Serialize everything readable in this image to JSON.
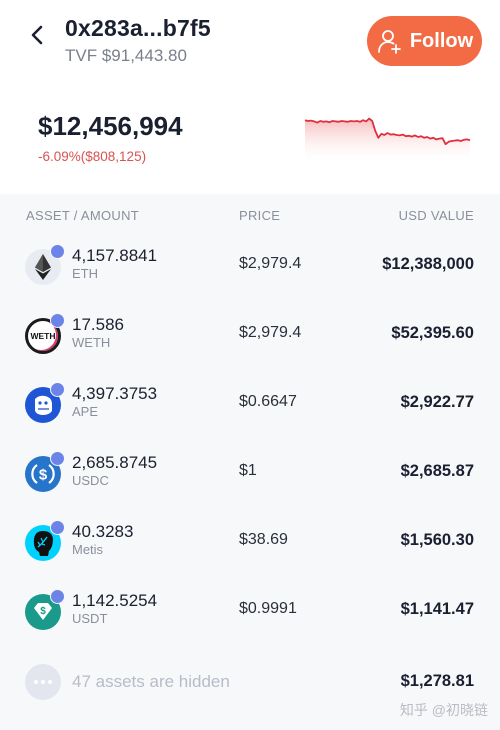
{
  "header": {
    "title": "0x283a...b7f5",
    "tvf": "TVF $91,443.80",
    "follow_label": "Follow"
  },
  "summary": {
    "total": "$12,456,994",
    "change": "-6.09%($808,125)",
    "accent_color": "#e0303e"
  },
  "chart_data": {
    "type": "line",
    "title": "",
    "xlabel": "",
    "ylabel": "",
    "note": "sparkline of portfolio value; relative values (0-100), no axes shown",
    "values": [
      82,
      80,
      81,
      79,
      76,
      80,
      78,
      79,
      77,
      80,
      79,
      78,
      80,
      79,
      78,
      80,
      79,
      80,
      78,
      82,
      79,
      86,
      80,
      55,
      38,
      48,
      45,
      50,
      46,
      47,
      45,
      44,
      46,
      42,
      43,
      41,
      44,
      40,
      42,
      38,
      40,
      36,
      38,
      34,
      36,
      37,
      22,
      28,
      30,
      31,
      32,
      30,
      33,
      34,
      32
    ],
    "line_color": "#e0303e",
    "fill": "gradient-red"
  },
  "table": {
    "headers": {
      "asset": "ASSET / AMOUNT",
      "price": "PRICE",
      "usd": "USD VALUE"
    },
    "rows": [
      {
        "amount": "4,157.8841",
        "symbol": "ETH",
        "price": "$2,979.4",
        "usd": "$12,388,000",
        "icon": "eth-icon"
      },
      {
        "amount": "17.586",
        "symbol": "WETH",
        "price": "$2,979.4",
        "usd": "$52,395.60",
        "icon": "weth-icon",
        "icon_text": "WETH"
      },
      {
        "amount": "4,397.3753",
        "symbol": "APE",
        "price": "$0.6647",
        "usd": "$2,922.77",
        "icon": "ape-icon"
      },
      {
        "amount": "2,685.8745",
        "symbol": "USDC",
        "price": "$1",
        "usd": "$2,685.87",
        "icon": "usdc-icon"
      },
      {
        "amount": "40.3283",
        "symbol": "Metis",
        "price": "$38.69",
        "usd": "$1,560.30",
        "icon": "metis-icon"
      },
      {
        "amount": "1,142.5254",
        "symbol": "USDT",
        "price": "$0.9991",
        "usd": "$1,141.47",
        "icon": "usdt-icon"
      }
    ],
    "hidden": {
      "label": "47 assets are hidden",
      "usd": "$1,278.81"
    }
  },
  "watermark": "知乎 @初晓链"
}
